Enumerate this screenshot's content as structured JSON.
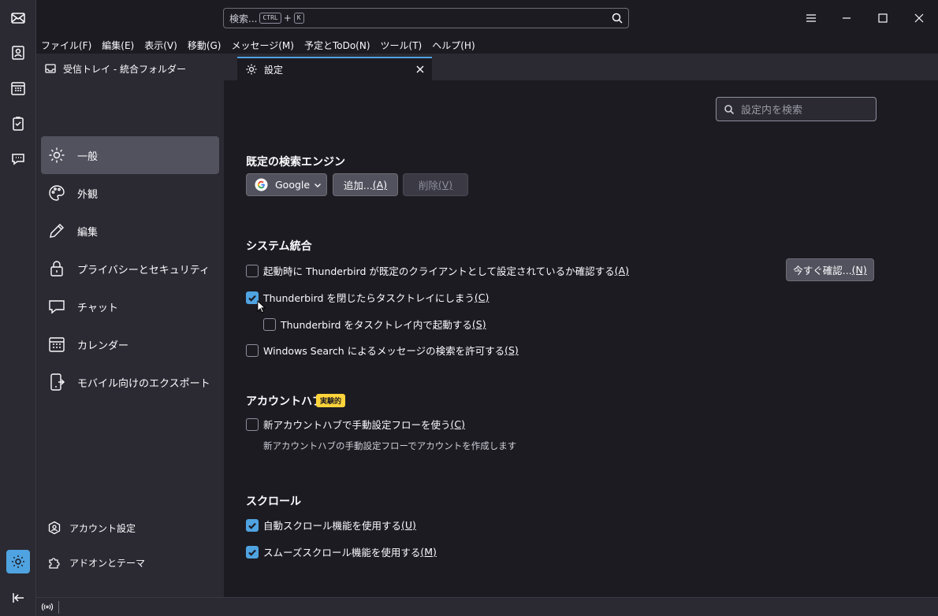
{
  "search": {
    "placeholder": "検索...",
    "shortcut_key1": "CTRL",
    "shortcut_plus": "+",
    "shortcut_key2": "K"
  },
  "menubar": [
    "ファイル(F)",
    "編集(E)",
    "表示(V)",
    "移動(G)",
    "メッセージ(M)",
    "予定とToDo(N)",
    "ツール(T)",
    "ヘルプ(H)"
  ],
  "tabs": [
    {
      "label": "受信トレイ - 統合フォルダー",
      "icon": "inbox-icon"
    },
    {
      "label": "設定",
      "icon": "gear-icon",
      "selected": true
    }
  ],
  "sidebar": {
    "categories": [
      {
        "label": "一般",
        "icon": "gear-icon",
        "active": true
      },
      {
        "label": "外観",
        "icon": "palette-icon"
      },
      {
        "label": "編集",
        "icon": "pencil-icon"
      },
      {
        "label": "プライバシーとセキュリティ",
        "icon": "lock-icon"
      },
      {
        "label": "チャット",
        "icon": "chat-icon"
      },
      {
        "label": "カレンダー",
        "icon": "calendar-icon"
      },
      {
        "label": "モバイル向けのエクスポート",
        "icon": "mobile-export-icon"
      }
    ],
    "links": [
      {
        "label": "アカウント設定",
        "icon": "account-icon"
      },
      {
        "label": "アドオンとテーマ",
        "icon": "puzzle-icon"
      }
    ]
  },
  "content": {
    "search_placeholder": "設定内を検索",
    "search_engine": {
      "title": "既定の検索エンジン",
      "selected_engine": "Google",
      "add_label": "追加...",
      "add_accesskey": "(A)",
      "remove_label": "削除",
      "remove_accesskey": "(V)"
    },
    "system_integration": {
      "title": "システム統合",
      "check_default": {
        "label": "起動時に Thunderbird が既定のクライアントとして設定されているか確認する",
        "accesskey": "(A)",
        "checked": false
      },
      "check_now_label": "今すぐ確認...",
      "check_now_accesskey": "(N)",
      "minimize_tray": {
        "label": "Thunderbird を閉じたらタスクトレイにしまう",
        "accesskey": "(C)",
        "checked": true
      },
      "start_in_tray": {
        "label": "Thunderbird をタスクトレイ内で起動する",
        "accesskey": "(S)",
        "checked": false
      },
      "windows_search": {
        "label": "Windows Search によるメッセージの検索を許可する",
        "accesskey": "(S)",
        "checked": false
      }
    },
    "account_hub": {
      "title": "アカウントハブ",
      "badge": "実験的",
      "manual_flow": {
        "label": "新アカウントハブで手動設定フローを使う",
        "accesskey": "(C)",
        "checked": false
      },
      "description": "新アカウントハブの手動設定フローでアカウントを作成します"
    },
    "scroll": {
      "title": "スクロール",
      "autoscroll": {
        "label": "自動スクロール機能を使用する",
        "accesskey": "(U)",
        "checked": true
      },
      "smooth_scroll": {
        "label": "スムーズスクロール機能を使用する",
        "accesskey": "(M)",
        "checked": true
      }
    }
  },
  "colors": {
    "accent": "#4fa3e0",
    "badge": "#ffd43b",
    "background": "#1c1b22",
    "panel": "#2b2a33"
  }
}
